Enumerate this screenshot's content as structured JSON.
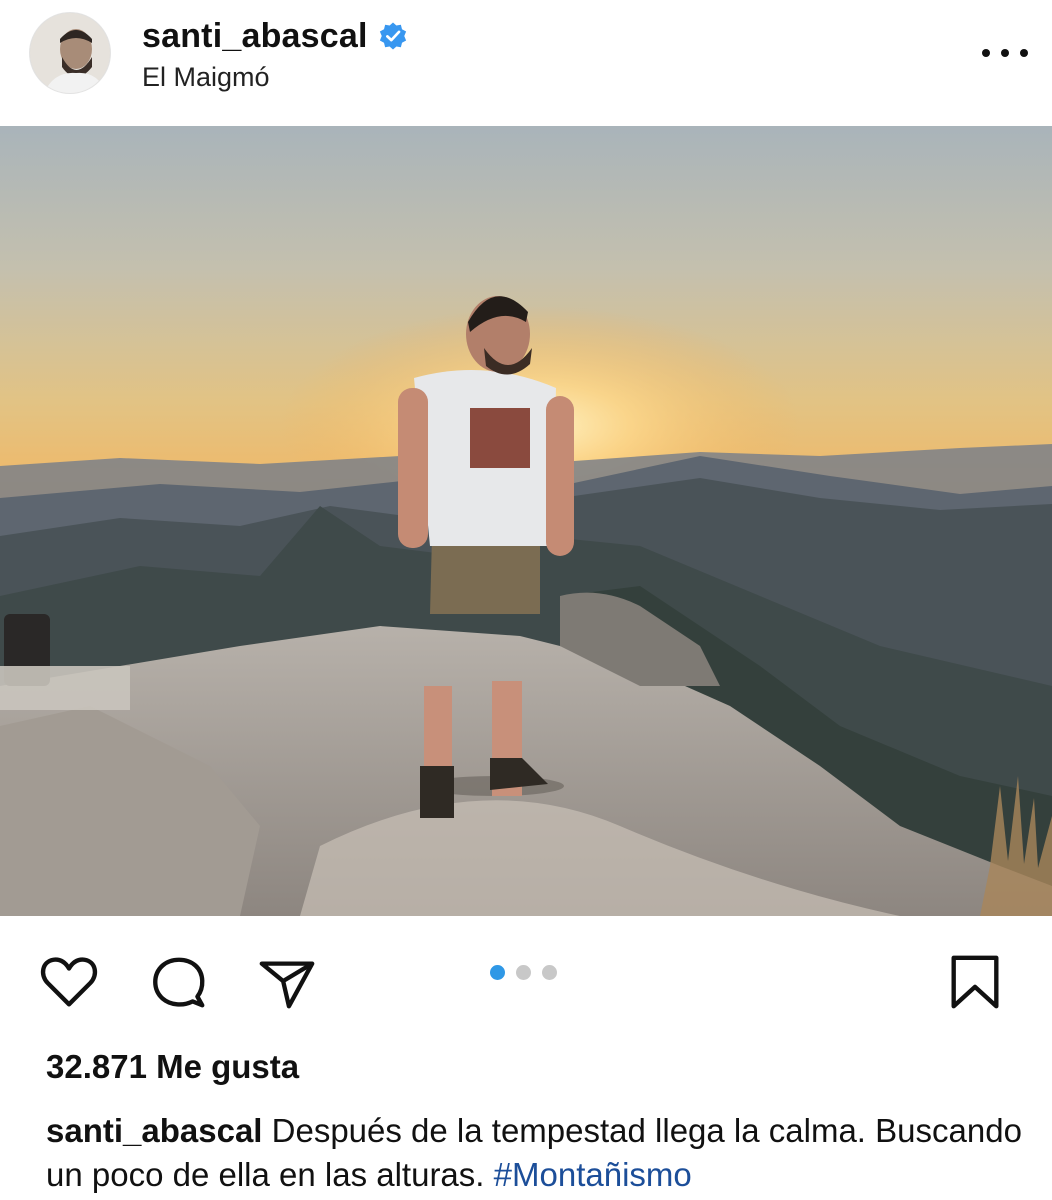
{
  "post": {
    "username": "santi_abascal",
    "location": "El Maigmó",
    "verified": true,
    "likes_text": "32.871 Me gusta",
    "caption": {
      "username": "santi_abascal",
      "text": "Después de la tempestad llega la calma. Buscando un poco de ella en las alturas.",
      "hashtag": "#Montañismo"
    }
  },
  "carousel": {
    "total": 3,
    "active_index": 0
  },
  "icons": {
    "verified": "verified-badge-icon",
    "more": "more-options-icon",
    "like": "heart-icon",
    "comment": "comment-icon",
    "share": "send-icon",
    "save": "bookmark-icon"
  },
  "colors": {
    "verified_blue": "#3897f0",
    "active_dot": "#2f98e6",
    "inactive_dot": "#c8c8c8",
    "hashtag": "#1c4e99"
  }
}
